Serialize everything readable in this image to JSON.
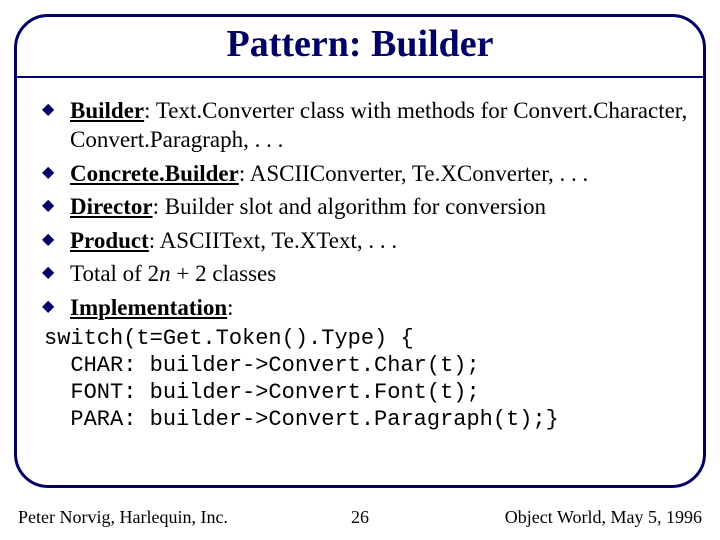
{
  "title": "Pattern: Builder",
  "bullets": [
    {
      "label": "Builder",
      "text": ": Text.Converter class with methods for Convert.Character, Convert.Paragraph, . . ."
    },
    {
      "label": "Concrete.Builder",
      "text": ": ASCIIConverter, Te.XConverter, . . ."
    },
    {
      "label": "Director",
      "text": ": Builder slot and algorithm for conversion"
    },
    {
      "label": "Product",
      "text": ": ASCIIText, Te.XText, . . ."
    },
    {
      "label": "",
      "text_pre": "Total of 2",
      "text_ital": "n",
      "text_post": " + 2 classes"
    },
    {
      "label": "Implementation",
      "text": ":"
    }
  ],
  "code": "switch(t=Get.Token().Type) {\n  CHAR: builder->Convert.Char(t);\n  FONT: builder->Convert.Font(t);\n  PARA: builder->Convert.Paragraph(t);}",
  "footer": {
    "left": "Peter Norvig, Harlequin, Inc.",
    "center": "26",
    "right": "Object World, May 5, 1996"
  }
}
